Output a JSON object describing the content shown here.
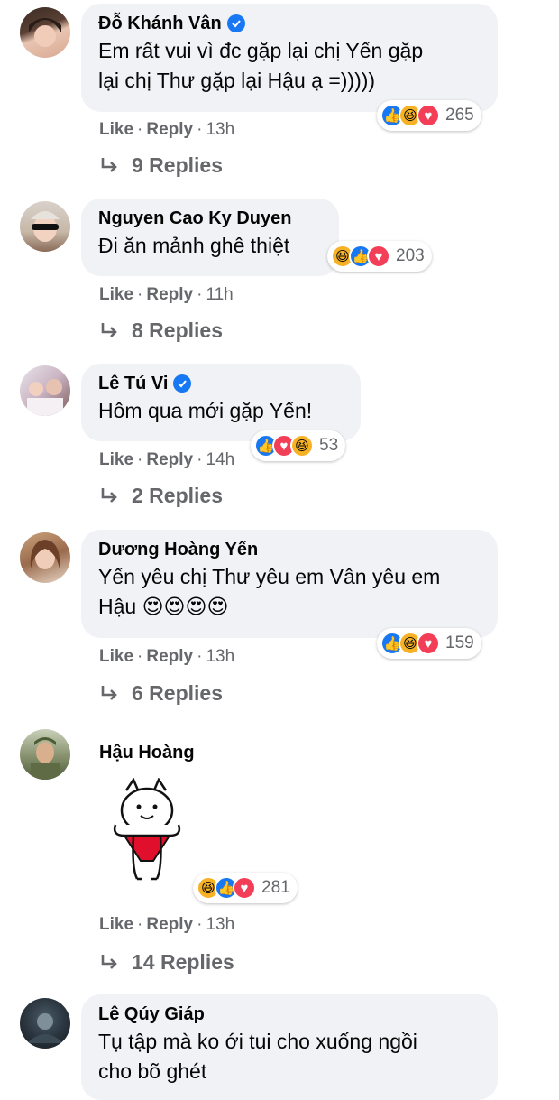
{
  "action_like": "Like",
  "action_reply": "Reply",
  "separator": "·",
  "comments": [
    {
      "author": "Đỗ Khánh Vân",
      "verified": true,
      "text_lines": [
        "Em rất vui vì đc gặp lại chị Yến gặp",
        "lại chị Thư gặp lại Hậu ạ =)))))"
      ],
      "reactions": [
        "like-icon",
        "haha-icon",
        "love-icon"
      ],
      "reaction_count": "265",
      "time": "13h",
      "replies": "9 Replies"
    },
    {
      "author": "Nguyen Cao Ky Duyen",
      "verified": false,
      "text_lines": [
        "Đi ăn mảnh ghê thiệt"
      ],
      "reactions": [
        "haha-icon",
        "like-icon",
        "love-icon"
      ],
      "reaction_count": "203",
      "time": "11h",
      "replies": "8 Replies"
    },
    {
      "author": "Lê Tú Vi",
      "verified": true,
      "text_lines": [
        "Hôm qua mới gặp Yến!"
      ],
      "reactions": [
        "like-icon",
        "love-icon",
        "haha-icon"
      ],
      "reaction_count": "53",
      "time": "14h",
      "replies": "2 Replies"
    },
    {
      "author": "Dương Hoàng Yến",
      "verified": false,
      "text_lines": [
        "Yến yêu chị Thư yêu em Vân yêu em",
        "Hậu 😍😍😍😍"
      ],
      "reactions": [
        "like-icon",
        "haha-icon",
        "love-icon"
      ],
      "reaction_count": "159",
      "time": "13h",
      "replies": "6 Replies"
    },
    {
      "author": "Hậu Hoàng",
      "verified": false,
      "sticker": "bunny-sticker",
      "reactions": [
        "haha-icon",
        "like-icon",
        "love-icon"
      ],
      "reaction_count": "281",
      "time": "13h",
      "replies": "14 Replies"
    },
    {
      "author": "Lê Qúy Giáp",
      "verified": false,
      "text_lines": [
        "Tụ tập mà ko ới tui cho xuống ngồi",
        "cho bõ ghét"
      ]
    }
  ]
}
